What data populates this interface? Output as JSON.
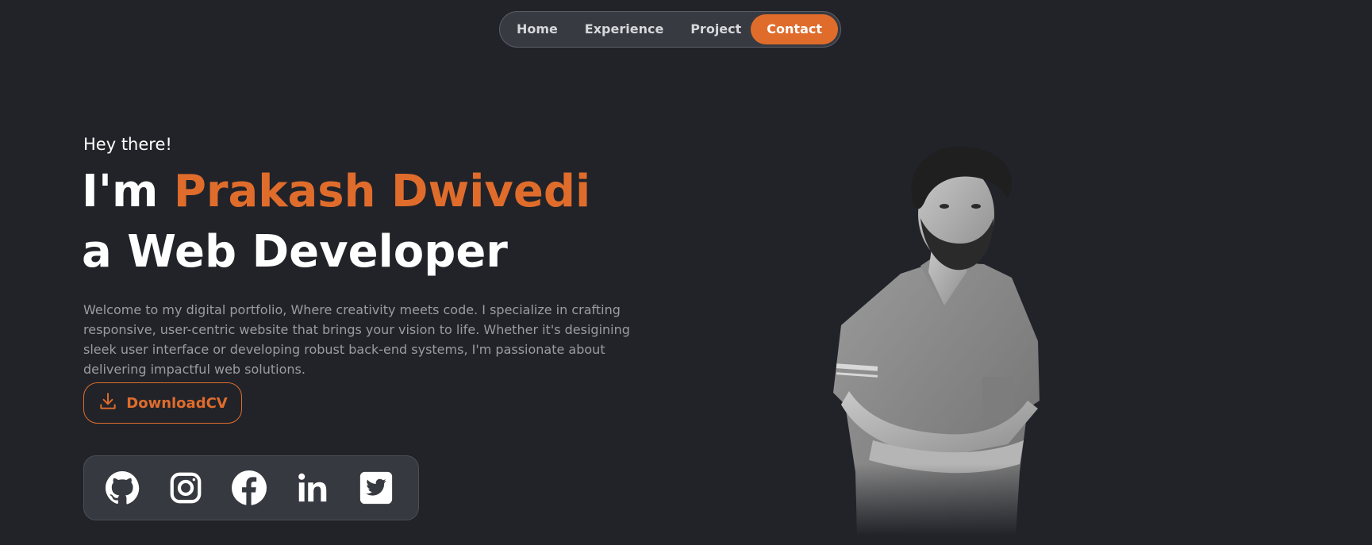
{
  "nav": {
    "items": [
      {
        "label": "Home"
      },
      {
        "label": "Experience"
      },
      {
        "label": "Project"
      },
      {
        "label": "Contact"
      }
    ],
    "active_index": 3
  },
  "hero": {
    "greeting": "Hey there!",
    "intro_prefix": "I'm ",
    "name": "Prakash Dwivedi",
    "role_line": "a Web Developer",
    "description": "Welcome to my digital portfolio, Where creativity meets code. I specialize in crafting responsive, user-centric website that brings your vision to life. Whether it's desigining sleek user interface or developing robust back-end systems, I'm passionate about delivering impactful web solutions.",
    "cv_button_label": "DownloadCV"
  },
  "socials": [
    {
      "icon": "github-icon"
    },
    {
      "icon": "instagram-icon"
    },
    {
      "icon": "facebook-icon"
    },
    {
      "icon": "linkedin-icon"
    },
    {
      "icon": "twitter-icon"
    }
  ],
  "colors": {
    "background": "#212329",
    "accent": "#e06c2c",
    "nav_bg": "#373a41",
    "muted_text": "#9a9ca3"
  }
}
